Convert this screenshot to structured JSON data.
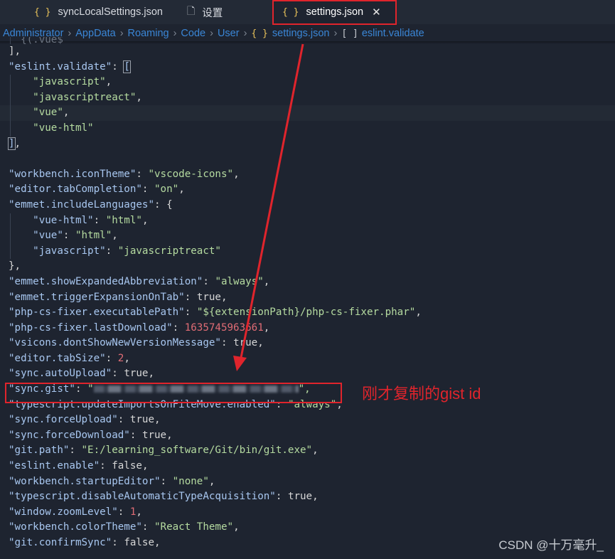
{
  "tabs": [
    {
      "icon": "{ }",
      "label": "syncLocalSettings.json"
    },
    {
      "icon": "file-icon",
      "label": "设置"
    },
    {
      "icon": "{ }",
      "label": "settings.json",
      "close": "✕"
    }
  ],
  "breadcrumb": {
    "items": [
      "Administrator",
      "AppData",
      "Roaming",
      "Code",
      "User"
    ],
    "file_icon": "{ }",
    "file": "settings.json",
    "array_icon": "[ ]",
    "key": "eslint.validate"
  },
  "code": {
    "l0": "  {(.vue$",
    "l1": "],",
    "l2_key": "\"eslint.validate\"",
    "l2_rest": ": ",
    "l2_br": "[",
    "l3": "\"javascript\"",
    "l4": "\"javascriptreact\"",
    "l5": "\"vue\"",
    "l6": "\"vue-html\"",
    "l7_br": "]",
    "l7_rest": ",",
    "l9_key": "\"workbench.iconTheme\"",
    "l9_val": "\"vscode-icons\"",
    "l10_key": "\"editor.tabCompletion\"",
    "l10_val": "\"on\"",
    "l11_key": "\"emmet.includeLanguages\"",
    "l11_rest": ": {",
    "l12_key": "\"vue-html\"",
    "l12_val": "\"html\"",
    "l13_key": "\"vue\"",
    "l13_val": "\"html\"",
    "l14_key": "\"javascript\"",
    "l14_val": "\"javascriptreact\"",
    "l15": "},",
    "l16_key": "\"emmet.showExpandedAbbreviation\"",
    "l16_val": "\"always\"",
    "l17_key": "\"emmet.triggerExpansionOnTab\"",
    "l17_val": "true",
    "l18_key": "\"php-cs-fixer.executablePath\"",
    "l18_val": "\"${extensionPath}/php-cs-fixer.phar\"",
    "l19_key": "\"php-cs-fixer.lastDownload\"",
    "l19_val": "1635745963661",
    "l20_key": "\"vsicons.dontShowNewVersionMessage\"",
    "l20_val": "true",
    "l21_key": "\"editor.tabSize\"",
    "l21_val": "2",
    "l22_key": "\"sync.autoUpload\"",
    "l22_val": "true",
    "l23_key": "\"sync.gist\"",
    "l23_open": "\"",
    "l23_close": "\",",
    "l24_key": "\"typescript.updateImportsOnFileMove.enabled\"",
    "l24_val": "\"always\"",
    "l25_key": "\"sync.forceUpload\"",
    "l25_val": "true",
    "l26_key": "\"sync.forceDownload\"",
    "l26_val": "true",
    "l27_key": "\"git.path\"",
    "l27_val": "\"E:/learning_software/Git/bin/git.exe\"",
    "l28_key": "\"eslint.enable\"",
    "l28_val": "false",
    "l29_key": "\"workbench.startupEditor\"",
    "l29_val": "\"none\"",
    "l30_key": "\"typescript.disableAutomaticTypeAcquisition\"",
    "l30_val": "true",
    "l31_key": "\"window.zoomLevel\"",
    "l31_val": "1",
    "l32_key": "\"workbench.colorTheme\"",
    "l32_val": "\"React Theme\"",
    "l33_key": "\"git.confirmSync\"",
    "l33_val": "false"
  },
  "annotation": "刚才复制的gist id",
  "watermark": "CSDN @十万毫升_",
  "colors": {
    "highlight": "#e0242c",
    "key": "#a8c7f0",
    "string": "#b5dba0",
    "number": "#e06c75"
  }
}
